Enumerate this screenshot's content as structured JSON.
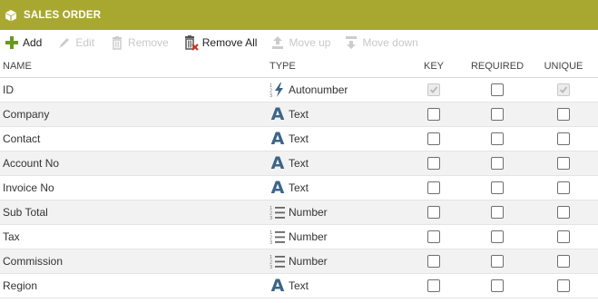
{
  "window": {
    "title": "SALES ORDER",
    "icon": "cube-icon"
  },
  "toolbar": {
    "add": "Add",
    "edit": "Edit",
    "remove": "Remove",
    "remove_all": "Remove All",
    "move_up": "Move up",
    "move_down": "Move down"
  },
  "columns": {
    "name": "NAME",
    "type": "TYPE",
    "key": "KEY",
    "required": "REQUIRED",
    "unique": "UNIQUE"
  },
  "rows": [
    {
      "name": "ID",
      "type": "Autonumber",
      "type_icon": "autonumber-icon",
      "key": true,
      "required": false,
      "unique": true,
      "key_disabled": true,
      "unique_disabled": true
    },
    {
      "name": "Company",
      "type": "Text",
      "type_icon": "text-type-icon",
      "key": false,
      "required": false,
      "unique": false
    },
    {
      "name": "Contact",
      "type": "Text",
      "type_icon": "text-type-icon",
      "key": false,
      "required": false,
      "unique": false
    },
    {
      "name": "Account No",
      "type": "Text",
      "type_icon": "text-type-icon",
      "key": false,
      "required": false,
      "unique": false
    },
    {
      "name": "Invoice No",
      "type": "Text",
      "type_icon": "text-type-icon",
      "key": false,
      "required": false,
      "unique": false
    },
    {
      "name": "Sub Total",
      "type": "Number",
      "type_icon": "number-type-icon",
      "key": false,
      "required": false,
      "unique": false
    },
    {
      "name": "Tax",
      "type": "Number",
      "type_icon": "number-type-icon",
      "key": false,
      "required": false,
      "unique": false
    },
    {
      "name": "Commission",
      "type": "Number",
      "type_icon": "number-type-icon",
      "key": false,
      "required": false,
      "unique": false
    },
    {
      "name": "Region",
      "type": "Text",
      "type_icon": "text-type-icon",
      "key": false,
      "required": false,
      "unique": false
    }
  ],
  "colors": {
    "title_bar": "#a8a830",
    "add_green": "#6a9a1e",
    "text_type_blue": "#3c6587",
    "remove_red": "#c0392b"
  }
}
